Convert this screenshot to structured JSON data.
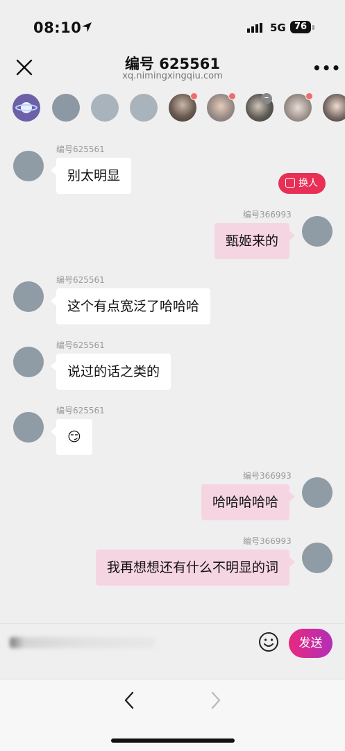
{
  "status_bar": {
    "time": "08:10",
    "network": "5G",
    "battery": "76"
  },
  "header": {
    "title": "编号 625561",
    "subtitle": "xq.nimingxingqiu.com"
  },
  "swap_button": {
    "label": "换人"
  },
  "messages": [
    {
      "side": "in",
      "sender": "编号625561",
      "text": "别太明显"
    },
    {
      "side": "out",
      "sender": "编号366993",
      "text": "甄姬来的"
    },
    {
      "side": "in",
      "sender": "编号625561",
      "text": "这个有点宽泛了哈哈哈"
    },
    {
      "side": "in",
      "sender": "编号625561",
      "text": "说过的话之类的"
    },
    {
      "side": "in",
      "sender": "编号625561",
      "text": "😏"
    },
    {
      "side": "out",
      "sender": "编号366993",
      "text": "哈哈哈哈哈"
    },
    {
      "side": "out",
      "sender": "编号366993",
      "text": "我再想想还有什么不明显的词"
    }
  ],
  "input": {
    "send_label": "发送"
  },
  "colors": {
    "accent": "#e8287e",
    "outgoing_bubble": "#f6d5e3",
    "swap_button": "#e82f55"
  }
}
